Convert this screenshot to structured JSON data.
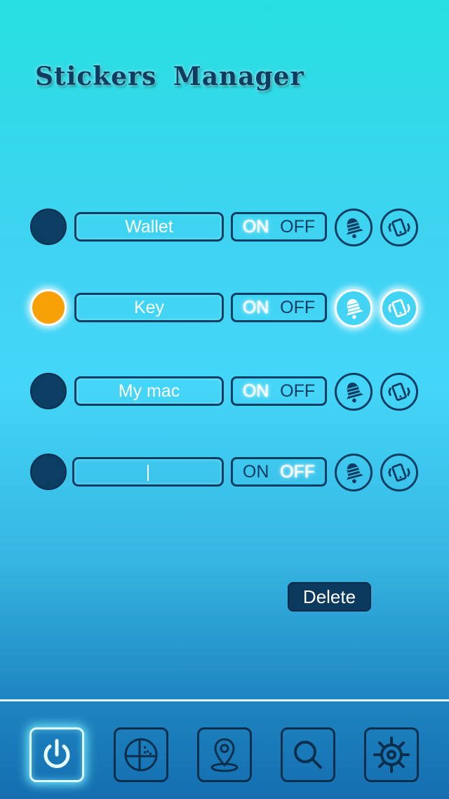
{
  "app": {
    "title": "Stickers Manager"
  },
  "toggle": {
    "on_label": "ON",
    "off_label": "OFF"
  },
  "stickers": [
    {
      "name": "Wallet",
      "active": false,
      "state": "ON"
    },
    {
      "name": "Key",
      "active": true,
      "state": "ON"
    },
    {
      "name": "My mac",
      "active": false,
      "state": "ON"
    },
    {
      "name": "|",
      "active": false,
      "state": "OFF"
    }
  ],
  "actions": {
    "delete_label": "Delete"
  },
  "tabs": [
    {
      "icon": "power-icon",
      "active": true
    },
    {
      "icon": "radar-icon",
      "active": false
    },
    {
      "icon": "location-pin-icon",
      "active": false
    },
    {
      "icon": "search-icon",
      "active": false
    },
    {
      "icon": "gear-icon",
      "active": false
    }
  ],
  "colors": {
    "accent_dark": "#0c3d63",
    "active_dot": "#f8a106",
    "background_top": "#26dfe0",
    "background_bottom": "#156eb0"
  }
}
